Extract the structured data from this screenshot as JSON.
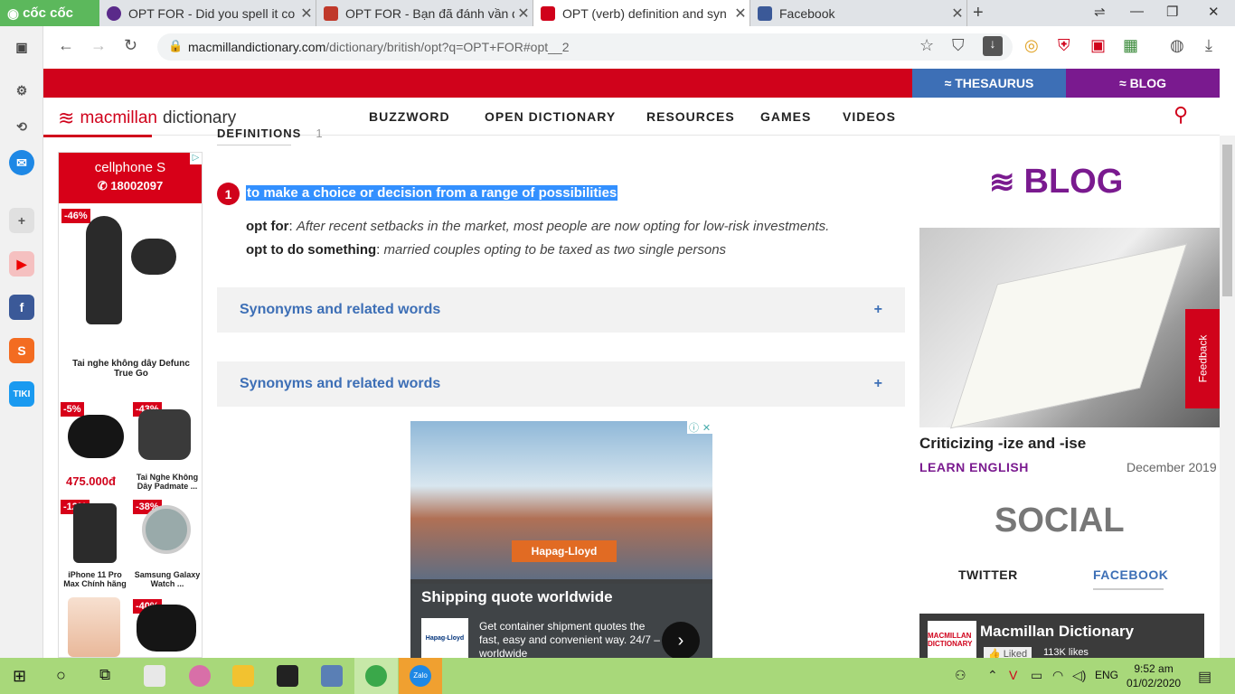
{
  "browser": {
    "brand": "cốc cốc",
    "tabs": [
      {
        "title": "OPT FOR - Did you spell it co",
        "icon": "viper-icon"
      },
      {
        "title": "OPT FOR - Bạn đã đánh vần đ",
        "icon": "shield-crest-icon"
      },
      {
        "title": "OPT (verb) definition and syn",
        "icon": "macmillan-icon"
      },
      {
        "title": "Facebook",
        "icon": "facebook-icon"
      }
    ],
    "url_host": "macmillandictionary.com",
    "url_path": "/dictionary/british/opt?q=OPT+FOR#opt__2"
  },
  "site": {
    "thesaurus": "THESAURUS",
    "blog_tab": "BLOG",
    "brand_a": "macmillan",
    "brand_b": "dictionary",
    "nav": [
      "BUZZWORD",
      "OPEN DICTIONARY",
      "RESOURCES",
      "GAMES",
      "VIDEOS"
    ]
  },
  "left_ad": {
    "brand": "cellphone S",
    "phone": "18002097",
    "main_discount": "-46%",
    "main_product": "Tai nghe không dây Defunc True Go",
    "items": [
      {
        "discount": "-5%",
        "price": "475.000đ"
      },
      {
        "discount": "-43%",
        "name": "Tai Nghe Không Dây Padmate ..."
      },
      {
        "discount": "-12%",
        "name": "iPhone 11 Pro Max Chính hãng"
      },
      {
        "discount": "-38%",
        "name": "Samsung Galaxy Watch ..."
      },
      {
        "discount": "-40%"
      }
    ]
  },
  "entry": {
    "section": "DEFINITIONS",
    "section_count": "1",
    "sense_number": "1",
    "definition": "to make a choice or decision from a range of possibilities",
    "examples": [
      {
        "pattern": "opt for",
        "text": "After recent setbacks in the market, most people are now opting for low-risk investments."
      },
      {
        "pattern": "opt to do something",
        "text": "married couples opting to be taxed as two single persons"
      }
    ],
    "synonyms": [
      {
        "label": "Synonyms and related words",
        "toggle": "+"
      },
      {
        "label": "Synonyms and related words",
        "toggle": "+"
      }
    ]
  },
  "center_ad": {
    "badge": "Hapag-Lloyd",
    "title": "Shipping quote worldwide",
    "body": "Get container shipment quotes the fast, easy and convenient way. 24/7 – worldwide",
    "logo": "Hapag-Lloyd"
  },
  "sidebar_right": {
    "blog_heading": "BLOG",
    "post_title": "Criticizing -ize and -ise",
    "post_category": "LEARN ENGLISH",
    "post_date": "December 2019",
    "feedback": "Feedback",
    "social_heading": "SOCIAL",
    "twitter": "TWITTER",
    "facebook": "FACEBOOK",
    "fb_page_name": "Macmillan Dictionary",
    "fb_like": "Liked",
    "fb_count": "113K likes",
    "fb_logo": "MACMILLAN DICTIONARY"
  },
  "taskbar": {
    "time": "9:52 am",
    "date": "01/02/2020",
    "lang": "ENG"
  },
  "colors": {
    "accent_red": "#d0021b",
    "thesaurus_blue": "#3d6fb6",
    "blog_purple": "#7a1a8f",
    "taskbar_green": "#a8d87a"
  }
}
